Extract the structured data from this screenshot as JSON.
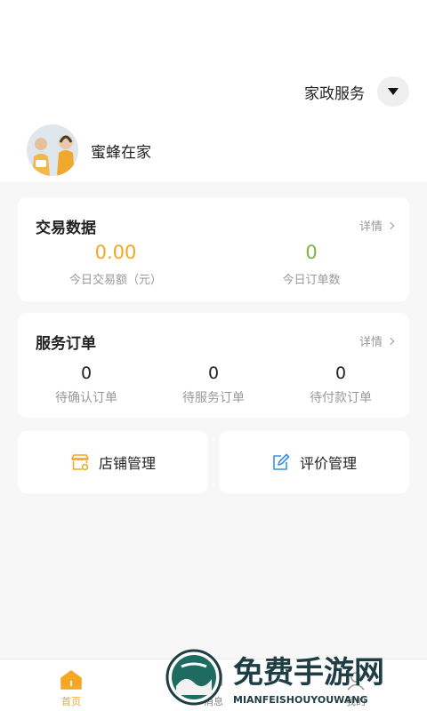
{
  "header": {
    "category_label": "家政服务",
    "store_name": "蜜蜂在家"
  },
  "trade": {
    "title": "交易数据",
    "more": "详情",
    "amount_value": "0.00",
    "amount_label": "今日交易额（元）",
    "orders_value": "0",
    "orders_label": "今日订单数"
  },
  "service_orders": {
    "title": "服务订单",
    "more": "详情",
    "items": [
      {
        "value": "0",
        "label": "待确认订单"
      },
      {
        "value": "0",
        "label": "待服务订单"
      },
      {
        "value": "0",
        "label": "待付款订单"
      }
    ]
  },
  "management": {
    "shop_label": "店铺管理",
    "review_label": "评价管理"
  },
  "tabbar": {
    "items": [
      {
        "label": "首页",
        "icon": "home-icon"
      },
      {
        "label": "消息",
        "icon": "message-icon"
      },
      {
        "label": "我的",
        "icon": "user-icon"
      }
    ]
  },
  "watermark": {
    "title": "免费手游网",
    "subtitle": "MIANFEISHOUYOUWANG"
  },
  "colors": {
    "accent": "#f5a623",
    "green": "#7cb342",
    "review_icon": "#3d8fe0",
    "background": "#f7f7f7"
  }
}
